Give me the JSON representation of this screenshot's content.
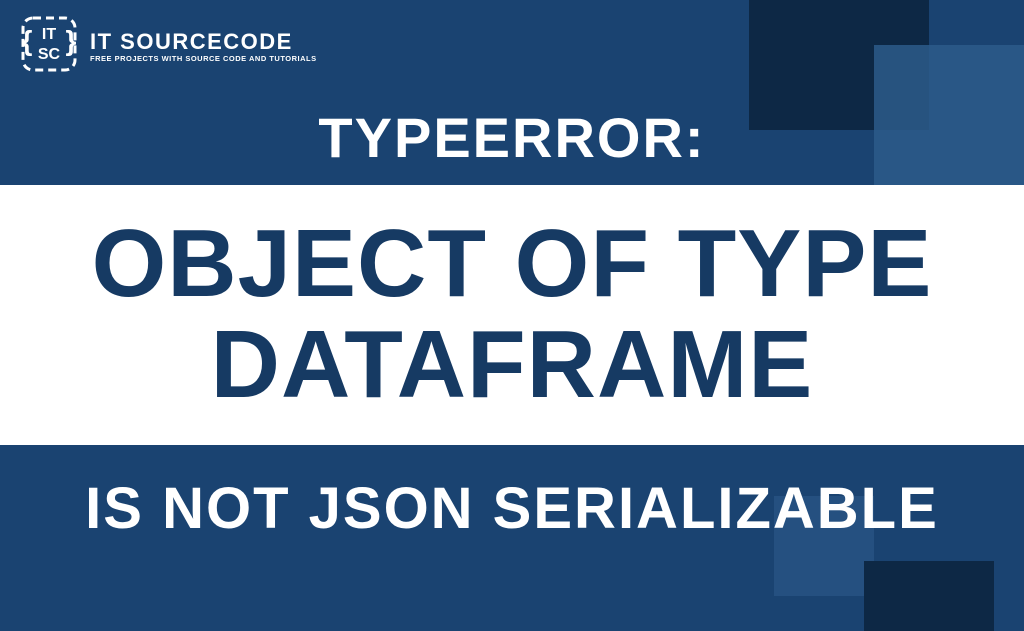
{
  "logo": {
    "title": "IT SOURCECODE",
    "tagline": "FREE PROJECTS WITH SOURCE CODE AND TUTORIALS"
  },
  "heading_top": "TYPEERROR:",
  "main_text": "OBJECT OF TYPE\nDATAFRAME",
  "heading_bottom": "IS NOT JSON SERIALIZABLE"
}
